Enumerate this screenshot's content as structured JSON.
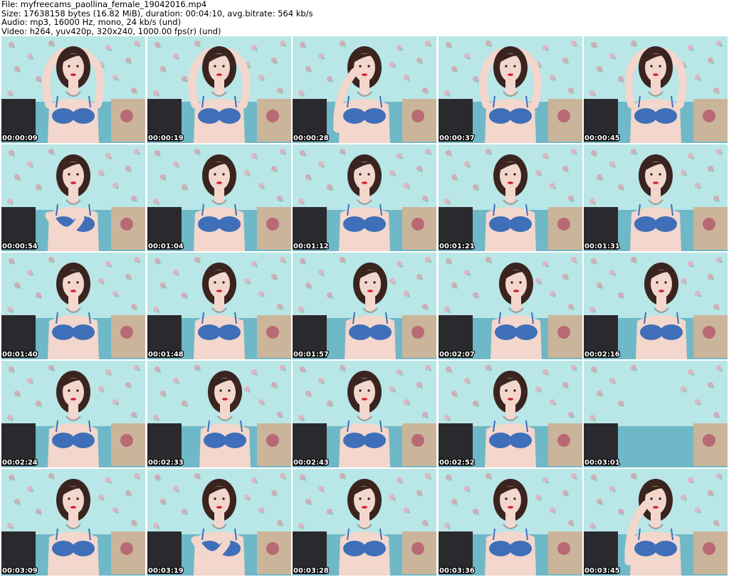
{
  "header": {
    "file_line": "File: myfreecams_paollina_female_19042016.mp4",
    "size_line": "Size: 17638158 bytes (16.82 MiB), duration: 00:04:10, avg.bitrate: 564 kb/s",
    "audio_line": "Audio: mp3, 16000 Hz, mono, 24 kb/s (und)",
    "video_line": "Video: h264, yuv420p, 320x240, 1000.00 fps(r) (und)"
  },
  "colors": {
    "wallpaper": "#b9e6e6",
    "bra": "#3f6fb8",
    "hair": "#3a2420",
    "skin": "#f3d6cc",
    "pillow_dark": "#2a2a2e",
    "pillow_floral": "#cbb59a"
  },
  "thumbnails": [
    {
      "timestamp": "00:00:09",
      "pose": "arms-up"
    },
    {
      "timestamp": "00:00:19",
      "pose": "arms-up"
    },
    {
      "timestamp": "00:00:28",
      "pose": "hand-face"
    },
    {
      "timestamp": "00:00:37",
      "pose": "arms-up"
    },
    {
      "timestamp": "00:00:45",
      "pose": "arms-up"
    },
    {
      "timestamp": "00:00:54",
      "pose": "arms-crossed"
    },
    {
      "timestamp": "00:01:04",
      "pose": "neutral"
    },
    {
      "timestamp": "00:01:12",
      "pose": "neutral"
    },
    {
      "timestamp": "00:01:21",
      "pose": "neutral"
    },
    {
      "timestamp": "00:01:31",
      "pose": "neutral"
    },
    {
      "timestamp": "00:01:40",
      "pose": "neutral"
    },
    {
      "timestamp": "00:01:48",
      "pose": "neutral"
    },
    {
      "timestamp": "00:01:57",
      "pose": "tilt"
    },
    {
      "timestamp": "00:02:07",
      "pose": "tilt"
    },
    {
      "timestamp": "00:02:16",
      "pose": "tilt"
    },
    {
      "timestamp": "00:02:24",
      "pose": "neutral"
    },
    {
      "timestamp": "00:02:33",
      "pose": "tilt"
    },
    {
      "timestamp": "00:02:43",
      "pose": "neutral"
    },
    {
      "timestamp": "00:02:52",
      "pose": "neutral"
    },
    {
      "timestamp": "00:03:01",
      "pose": "off-frame"
    },
    {
      "timestamp": "00:03:09",
      "pose": "neutral"
    },
    {
      "timestamp": "00:03:19",
      "pose": "hand-chest"
    },
    {
      "timestamp": "00:03:28",
      "pose": "neutral"
    },
    {
      "timestamp": "00:03:36",
      "pose": "neutral"
    },
    {
      "timestamp": "00:03:45",
      "pose": "hand-face"
    }
  ]
}
